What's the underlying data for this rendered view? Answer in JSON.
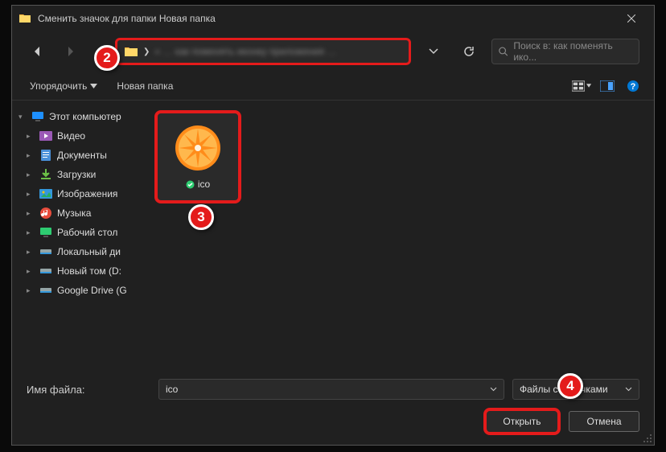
{
  "title": "Сменить значок для папки Новая папка",
  "address": "« … как поменять иконку приложения …",
  "search_placeholder": "Поиск в: как поменять ико...",
  "toolbar": {
    "organize": "Упорядочить",
    "new_folder": "Новая папка"
  },
  "sidebar": {
    "root": "Этот компьютер",
    "items": [
      {
        "label": "Видео"
      },
      {
        "label": "Документы"
      },
      {
        "label": "Загрузки"
      },
      {
        "label": "Изображения"
      },
      {
        "label": "Музыка"
      },
      {
        "label": "Рабочий стол"
      },
      {
        "label": "Локальный ди"
      },
      {
        "label": "Новый том (D:"
      },
      {
        "label": "Google Drive (G"
      }
    ]
  },
  "file": {
    "name": "ico"
  },
  "footer": {
    "filename_label": "Имя файла:",
    "filename_value": "ico",
    "filter": "Файлы со значками",
    "open": "Открыть",
    "cancel": "Отмена"
  },
  "badges": {
    "b2": "2",
    "b3": "3",
    "b4": "4"
  }
}
